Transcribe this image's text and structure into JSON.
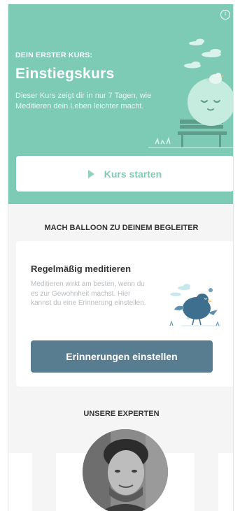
{
  "hero": {
    "kicker": "DEIN ERSTER KURS:",
    "title": "Einstiegskurs",
    "description": "Dieser Kurs zeigt dir in nur 7 Tagen, wie Meditieren dein Leben leichter macht.",
    "start_label": "Kurs starten"
  },
  "balloon": {
    "section_title": "MACH BALLOON ZU DEINEM BEGLEITER",
    "card_title": "Regelmäßig meditieren",
    "card_desc": "Meditieren wirkt am besten, wenn du es zur Gewohnheit machst. Hier kannst du eine Erinnerung einstellen.",
    "button_label": "Erinnerungen einstellen"
  },
  "experts": {
    "section_title": "UNSERE EXPERTEN"
  },
  "colors": {
    "accent": "#7ecbb5",
    "button_dark": "#587d91",
    "background": "#f5f5f5"
  },
  "icons": [
    "info-icon",
    "play-icon",
    "meditation-balloon-illustration",
    "bird-illustration"
  ]
}
